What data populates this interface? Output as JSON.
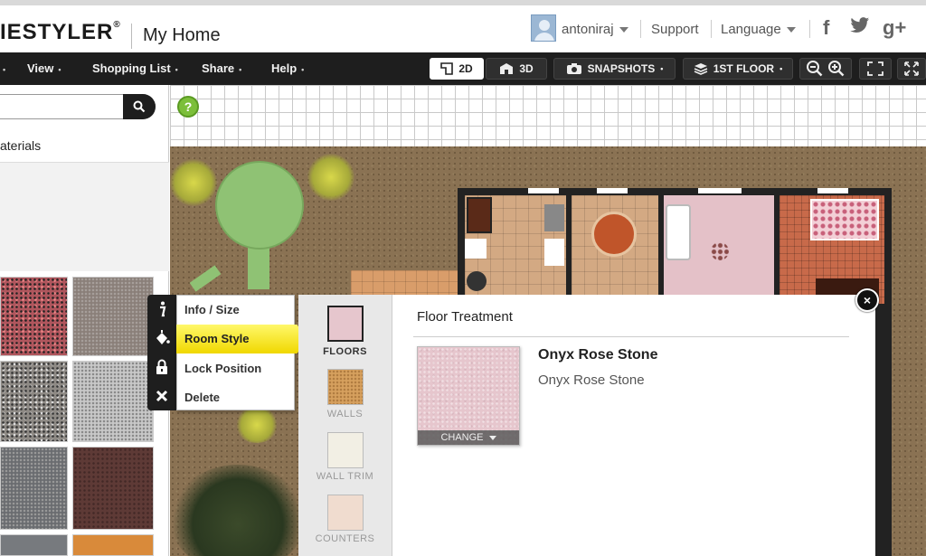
{
  "header": {
    "logo_text": "IESTYLER",
    "logo_mark": "®",
    "page_title": "My Home",
    "user_name": "antoniraj",
    "support_label": "Support",
    "language_label": "Language",
    "social": [
      "f",
      "t",
      "g+"
    ]
  },
  "menubar": {
    "items": [
      "View",
      "Shopping List",
      "Share",
      "Help"
    ],
    "dot": "•",
    "btn_2d": "2D",
    "btn_3d": "3D",
    "btn_snapshots": "SNAPSHOTS",
    "btn_floor": "1ST FLOOR"
  },
  "left_panel": {
    "search_placeholder": "",
    "materials_title": "aterials"
  },
  "canvas": {
    "help_label": "?"
  },
  "context_menu": {
    "items": [
      "Info / Size",
      "Room Style",
      "Lock Position",
      "Delete"
    ],
    "selected_index": 1
  },
  "style_panel": {
    "tabs": [
      "FLOORS",
      "WALLS",
      "WALL TRIM",
      "COUNTERS"
    ],
    "active_tab": "FLOORS",
    "title": "Floor Treatment",
    "material_name": "Onyx Rose Stone",
    "material_subtitle": "Onyx Rose Stone",
    "change_label": "CHANGE",
    "close_label": "×"
  },
  "colors": {
    "accent_yellow": "#f0d800",
    "toolbar_bg": "#1e1e1e",
    "ground": "#8a7253",
    "floor_swatch": "#e6c6cd"
  }
}
